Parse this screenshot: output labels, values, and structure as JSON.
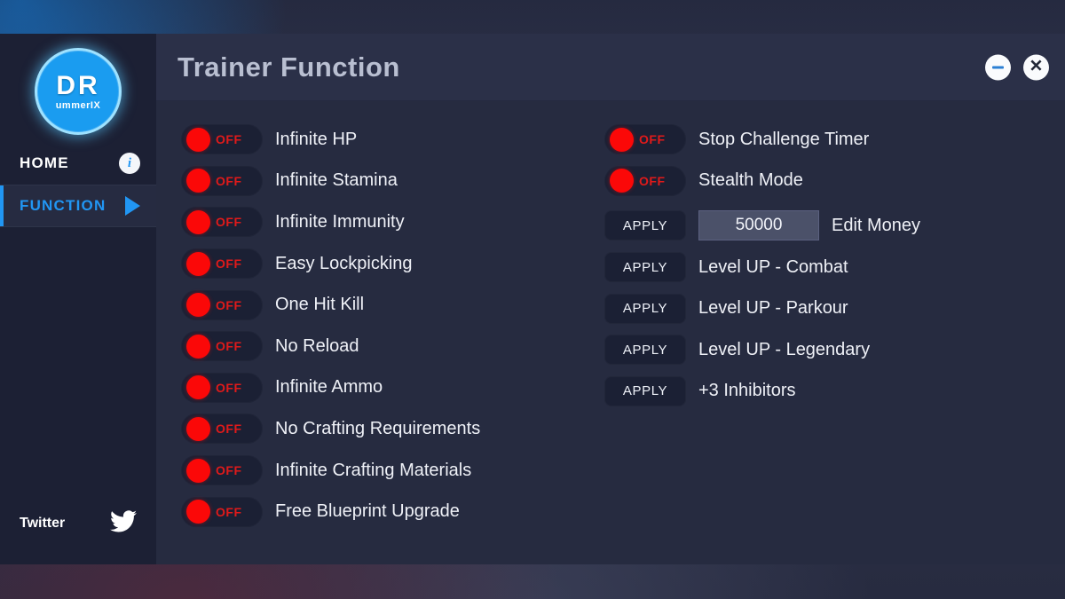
{
  "window": {
    "title": "Trainer Function",
    "controls": {
      "minimize": "minimize-button",
      "close": "close-button",
      "close_glyph": "✕"
    }
  },
  "sidebar": {
    "logo": {
      "main": "DR",
      "sub": "ummerIX"
    },
    "nav": [
      {
        "label": "HOME",
        "icon": "info-icon",
        "icon_glyph": "i",
        "active": false
      },
      {
        "label": "FUNCTION",
        "icon": "play-triangle-icon",
        "active": true
      }
    ],
    "social": {
      "label": "Twitter",
      "icon": "twitter-bird-icon"
    }
  },
  "colors": {
    "accent_blue": "#2196f3",
    "logo_blue": "#1a9cf0",
    "toggle_red": "#fb0808",
    "off_text_red": "#e01a1a",
    "sidebar_bg": "#1c2034",
    "content_bg": "#262b40",
    "titlebar_bg": "#2b3048",
    "title_text": "#b9bfd1",
    "label_text": "#eff1f7",
    "input_bg": "#4b5169"
  },
  "left_column": [
    {
      "type": "toggle",
      "state": "OFF",
      "label": "Infinite HP"
    },
    {
      "type": "toggle",
      "state": "OFF",
      "label": "Infinite Stamina"
    },
    {
      "type": "toggle",
      "state": "OFF",
      "label": "Infinite Immunity"
    },
    {
      "type": "toggle",
      "state": "OFF",
      "label": "Easy Lockpicking"
    },
    {
      "type": "toggle",
      "state": "OFF",
      "label": "One Hit Kill"
    },
    {
      "type": "toggle",
      "state": "OFF",
      "label": "No Reload"
    },
    {
      "type": "toggle",
      "state": "OFF",
      "label": "Infinite Ammo"
    },
    {
      "type": "toggle",
      "state": "OFF",
      "label": "No Crafting Requirements"
    },
    {
      "type": "toggle",
      "state": "OFF",
      "label": "Infinite Crafting Materials"
    },
    {
      "type": "toggle",
      "state": "OFF",
      "label": "Free Blueprint Upgrade"
    }
  ],
  "right_column": [
    {
      "type": "toggle",
      "state": "OFF",
      "label": "Stop Challenge Timer"
    },
    {
      "type": "toggle",
      "state": "OFF",
      "label": "Stealth Mode"
    },
    {
      "type": "apply_input",
      "button": "APPLY",
      "value": "50000",
      "label": "Edit Money"
    },
    {
      "type": "apply",
      "button": "APPLY",
      "label": "Level UP - Combat"
    },
    {
      "type": "apply",
      "button": "APPLY",
      "label": "Level UP - Parkour"
    },
    {
      "type": "apply",
      "button": "APPLY",
      "label": "Level UP - Legendary"
    },
    {
      "type": "apply",
      "button": "APPLY",
      "label": "+3 Inhibitors"
    }
  ]
}
